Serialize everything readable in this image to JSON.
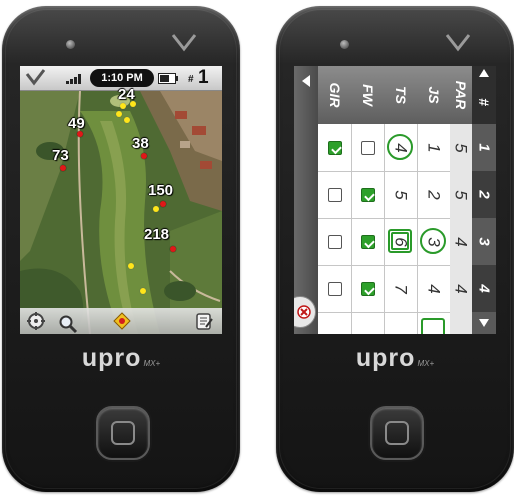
{
  "devices": [
    {
      "brand": "upro",
      "model": "MX+"
    },
    {
      "brand": "upro",
      "model": "MX+"
    }
  ],
  "map_screen": {
    "status": {
      "time": "1:10 PM",
      "hole_hash": "#",
      "hole_number": "1"
    },
    "distances": [
      "24",
      "49",
      "38",
      "73",
      "150",
      "218"
    ],
    "icons": {
      "confirm": "checkmark-icon",
      "signal": "signal-icon",
      "battery": "battery-icon",
      "target": "crosshair-icon",
      "zoom": "magnifier-icon",
      "flag": "pin-icon",
      "scorecard": "notepad-icon"
    }
  },
  "score_screen": {
    "columns": [
      "GIR",
      "FW",
      "TS",
      "JS",
      "PAR",
      "#"
    ],
    "rows": [
      {
        "hole": "1",
        "par": "5",
        "js": "1",
        "ts": "4",
        "fw": false,
        "gir": true
      },
      {
        "hole": "2",
        "par": "5",
        "js": "2",
        "ts": "5",
        "fw": true,
        "gir": false
      },
      {
        "hole": "3",
        "par": "4",
        "js": "3",
        "ts": "6",
        "fw": true,
        "gir": false
      },
      {
        "hole": "4",
        "par": "4",
        "js": "4",
        "ts": "7",
        "fw": true,
        "gir": false
      }
    ],
    "accent_color": "#2a9a2a"
  }
}
